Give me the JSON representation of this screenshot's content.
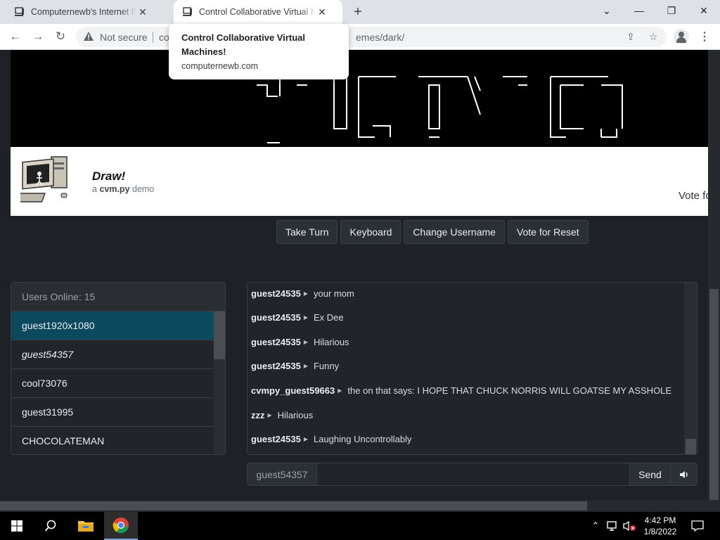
{
  "browser": {
    "tabs": [
      {
        "title": "Computernewb's Internet Pub Hub",
        "active": false
      },
      {
        "title": "Control Collaborative Virtual Machines!",
        "active": true
      }
    ],
    "new_tab_label": "+",
    "security_label": "Not secure",
    "url_visible_start": "co",
    "url_visible_end": "emes/dark/"
  },
  "hovercard": {
    "title": "Control Collaborative Virtual Machines!",
    "domain": "computernewb.com"
  },
  "vm": {
    "title": "Draw!",
    "subtitle_prefix": "a",
    "subtitle_strong": "cvm.py",
    "subtitle_suffix": "demo",
    "vote_text": "Vote fo"
  },
  "actions": [
    "Take Turn",
    "Keyboard",
    "Change Username",
    "Vote for Reset"
  ],
  "users": {
    "header": "Users Online: 15",
    "list": [
      {
        "name": "guest1920x1080",
        "active": true,
        "italic": false
      },
      {
        "name": "guest54357",
        "active": false,
        "italic": true
      },
      {
        "name": "cool73076",
        "active": false,
        "italic": false
      },
      {
        "name": "guest31995",
        "active": false,
        "italic": false
      },
      {
        "name": "CHOCOLATEMAN",
        "active": false,
        "italic": false
      }
    ]
  },
  "chat": {
    "messages": [
      {
        "user": "guest24535",
        "text": "your mom"
      },
      {
        "user": "guest24535",
        "text": "Ex Dee"
      },
      {
        "user": "guest24535",
        "text": "Hilarious"
      },
      {
        "user": "guest24535",
        "text": "Funny"
      },
      {
        "user": "cvmpy_guest59663",
        "text": "the on that says: I HOPE THAT CHUCK NORRIS WILL GOATSE MY ASSHOLE"
      },
      {
        "user": "zzz",
        "text": "Hilarious"
      },
      {
        "user": "guest24535",
        "text": "Laughing Uncontrollably"
      }
    ],
    "username_label": "guest54357",
    "input_value": "",
    "send_label": "Send"
  },
  "taskbar": {
    "time": "4:42 PM",
    "date": "1/8/2022"
  },
  "colors": {
    "page_bg": "#1e2125",
    "active_user": "#0b4a5e",
    "panel_bg": "#212529"
  }
}
